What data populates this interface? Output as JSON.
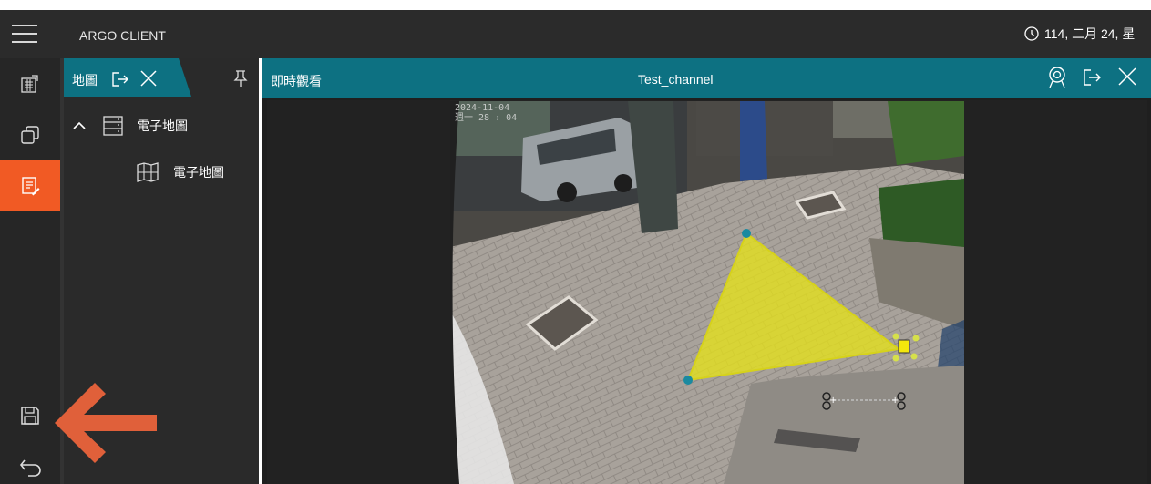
{
  "app": {
    "title": "ARGO CLIENT",
    "clock_text": "114, 二月 24, 星"
  },
  "map_panel": {
    "tab_label": "地圖",
    "tree": [
      {
        "label": "電子地圖",
        "type": "folder",
        "expanded": true
      },
      {
        "label": "電子地圖",
        "type": "map"
      }
    ]
  },
  "view_panel": {
    "title_left": "即時觀看",
    "title_center": "Test_channel"
  },
  "camera": {
    "osd_line1": "2024-11-04",
    "osd_line2": "週一 28 : 04",
    "zone_color": "#e6e11a"
  },
  "colors": {
    "accent_teal": "#0d7182",
    "accent_orange": "#f15a24",
    "arrow": "#e0603a"
  }
}
